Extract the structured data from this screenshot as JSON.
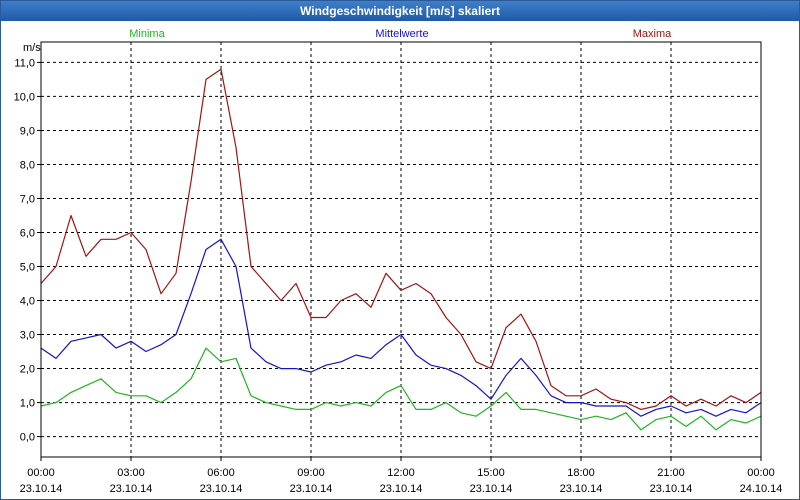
{
  "window": {
    "title": "Windgeschwindigkeit [m/s] skaliert"
  },
  "chart_data": {
    "type": "line",
    "title": "Windgeschwindigkeit [m/s] skaliert",
    "ylabel": "m/s",
    "xlabel": "",
    "ylim": [
      -0.6,
      11.6
    ],
    "xlim": [
      0,
      24
    ],
    "yticks": [
      0,
      1,
      2,
      3,
      4,
      5,
      6,
      7,
      8,
      9,
      10,
      11
    ],
    "ytick_labels": [
      "0,0",
      "1,0",
      "2,0",
      "3,0",
      "4,0",
      "5,0",
      "6,0",
      "7,0",
      "8,0",
      "9,0",
      "10,0",
      "11,0"
    ],
    "xticks": [
      {
        "time": "00:00",
        "date": "23.10.14"
      },
      {
        "time": "03:00",
        "date": "23.10.14"
      },
      {
        "time": "06:00",
        "date": "23.10.14"
      },
      {
        "time": "09:00",
        "date": "23.10.14"
      },
      {
        "time": "12:00",
        "date": "23.10.14"
      },
      {
        "time": "15:00",
        "date": "23.10.14"
      },
      {
        "time": "18:00",
        "date": "23.10.14"
      },
      {
        "time": "21:00",
        "date": "23.10.14"
      },
      {
        "time": "00:00",
        "date": "24.10.14"
      }
    ],
    "grid": true,
    "legend": "top",
    "series": [
      {
        "name": "Minima",
        "color": "#22b422",
        "x": [
          0,
          0.5,
          1,
          1.5,
          2,
          2.5,
          3,
          3.5,
          4,
          4.5,
          5,
          5.5,
          6,
          6.5,
          7,
          7.5,
          8,
          8.5,
          9,
          9.5,
          10,
          10.5,
          11,
          11.5,
          12,
          12.5,
          13,
          13.5,
          14,
          14.5,
          15,
          15.5,
          16,
          16.5,
          17,
          17.5,
          18,
          18.5,
          19,
          19.5,
          20,
          20.5,
          21,
          21.5,
          22,
          22.5,
          23,
          23.5,
          24
        ],
        "values": [
          0.9,
          1.0,
          1.3,
          1.5,
          1.7,
          1.3,
          1.2,
          1.2,
          1.0,
          1.3,
          1.7,
          2.6,
          2.2,
          2.3,
          1.2,
          1.0,
          0.9,
          0.8,
          0.8,
          1.0,
          0.9,
          1.0,
          0.9,
          1.3,
          1.5,
          0.8,
          0.8,
          1.0,
          0.7,
          0.6,
          0.9,
          1.3,
          0.8,
          0.8,
          0.7,
          0.6,
          0.5,
          0.6,
          0.5,
          0.7,
          0.2,
          0.5,
          0.6,
          0.3,
          0.6,
          0.2,
          0.5,
          0.4,
          0.6
        ]
      },
      {
        "name": "Mittelwerte",
        "color": "#1414c8",
        "x": [
          0,
          0.5,
          1,
          1.5,
          2,
          2.5,
          3,
          3.5,
          4,
          4.5,
          5,
          5.5,
          6,
          6.5,
          7,
          7.5,
          8,
          8.5,
          9,
          9.5,
          10,
          10.5,
          11,
          11.5,
          12,
          12.5,
          13,
          13.5,
          14,
          14.5,
          15,
          15.5,
          16,
          16.5,
          17,
          17.5,
          18,
          18.5,
          19,
          19.5,
          20,
          20.5,
          21,
          21.5,
          22,
          22.5,
          23,
          23.5,
          24
        ],
        "values": [
          2.6,
          2.3,
          2.8,
          2.9,
          3.0,
          2.6,
          2.8,
          2.5,
          2.7,
          3.0,
          4.2,
          5.5,
          5.8,
          5.0,
          2.6,
          2.2,
          2.0,
          2.0,
          1.9,
          2.1,
          2.2,
          2.4,
          2.3,
          2.7,
          3.0,
          2.4,
          2.1,
          2.0,
          1.8,
          1.5,
          1.1,
          1.8,
          2.3,
          1.8,
          1.2,
          1.0,
          1.0,
          0.9,
          0.9,
          0.9,
          0.6,
          0.8,
          0.9,
          0.7,
          0.8,
          0.6,
          0.8,
          0.7,
          1.0
        ]
      },
      {
        "name": "Maxima",
        "color": "#a01414",
        "x": [
          0,
          0.5,
          1,
          1.5,
          2,
          2.5,
          3,
          3.5,
          4,
          4.5,
          5,
          5.5,
          6,
          6.5,
          7,
          7.5,
          8,
          8.5,
          9,
          9.5,
          10,
          10.5,
          11,
          11.5,
          12,
          12.5,
          13,
          13.5,
          14,
          14.5,
          15,
          15.5,
          16,
          16.5,
          17,
          17.5,
          18,
          18.5,
          19,
          19.5,
          20,
          20.5,
          21,
          21.5,
          22,
          22.5,
          23,
          23.5,
          24
        ],
        "values": [
          4.5,
          5.0,
          6.5,
          5.3,
          5.8,
          5.8,
          6.0,
          5.5,
          4.2,
          4.8,
          7.5,
          10.5,
          10.8,
          8.5,
          5.0,
          4.5,
          4.0,
          4.5,
          3.5,
          3.5,
          4.0,
          4.2,
          3.8,
          4.8,
          4.3,
          4.5,
          4.2,
          3.5,
          3.0,
          2.2,
          2.0,
          3.2,
          3.6,
          2.8,
          1.5,
          1.2,
          1.2,
          1.4,
          1.1,
          1.0,
          0.8,
          0.9,
          1.2,
          0.9,
          1.1,
          0.9,
          1.2,
          1.0,
          1.3
        ]
      }
    ]
  }
}
